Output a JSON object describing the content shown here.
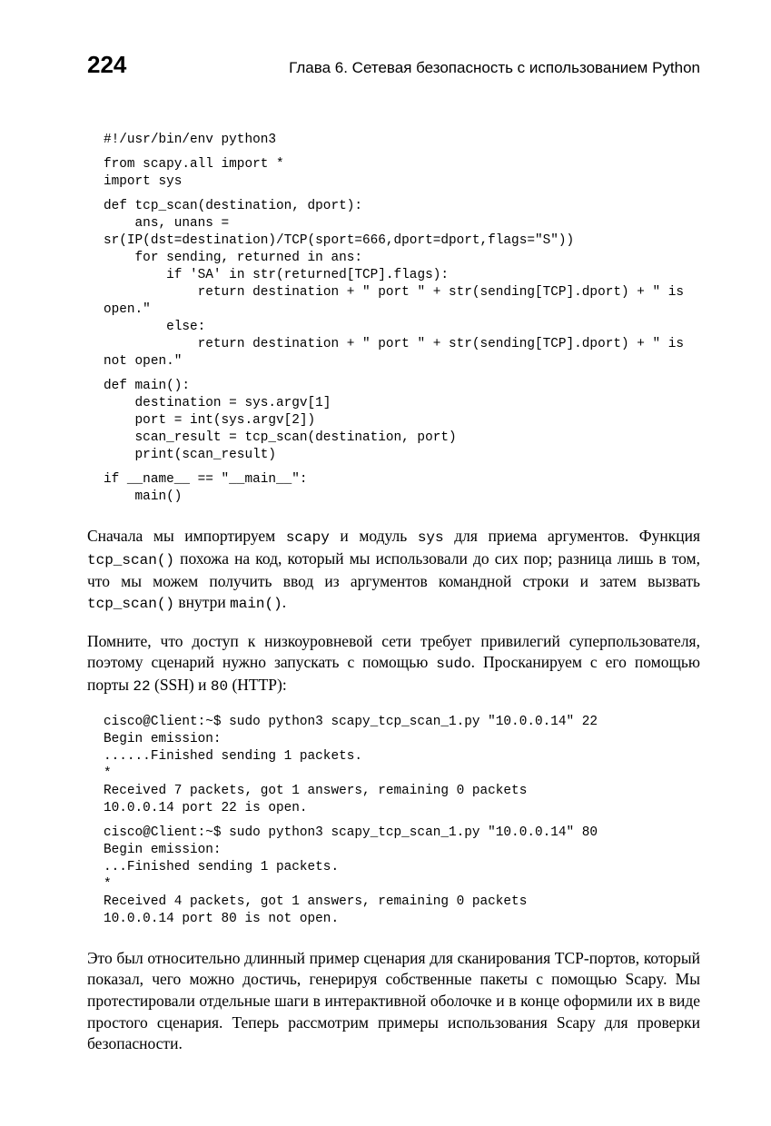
{
  "header": {
    "page_number": "224",
    "chapter_title": "Глава 6. Сетевая безопасность с использованием Python"
  },
  "code1": {
    "l1": "#!/usr/bin/env python3",
    "l2": "from scapy.all import *",
    "l3": "import sys",
    "l4": "def tcp_scan(destination, dport):",
    "l5": "    ans, unans = sr(IP(dst=destination)/TCP(sport=666,dport=dport,flags=\"S\"))",
    "l6": "    for sending, returned in ans:",
    "l7": "        if 'SA' in str(returned[TCP].flags):",
    "l8": "            return destination + \" port \" + str(sending[TCP].dport) + \" is open.\"",
    "l9": "        else:",
    "l10": "            return destination + \" port \" + str(sending[TCP].dport) + \" is not open.\"",
    "l11": "def main():",
    "l12": "    destination = sys.argv[1]",
    "l13": "    port = int(sys.argv[2])",
    "l14": "    scan_result = tcp_scan(destination, port)",
    "l15": "    print(scan_result)",
    "l16": "if __name__ == \"__main__\":",
    "l17": "    main()"
  },
  "para1": {
    "t1": "Сначала мы импортируем ",
    "m1": "scapy",
    "t2": " и модуль ",
    "m2": "sys",
    "t3": " для приема аргументов. Функция ",
    "m3": "tcp_scan()",
    "t4": " похожа на код, который мы использовали до сих пор; разница лишь в том, что мы можем получить ввод из аргументов командной строки и затем вызвать ",
    "m4": "tcp_scan()",
    "t5": " внутри ",
    "m5": "main()",
    "t6": "."
  },
  "para2": {
    "t1": "Помните, что доступ к низкоуровневой сети требует привилегий суперпользователя, поэтому сценарий нужно запускать с помощью ",
    "m1": "sudo",
    "t2": ". Просканируем с его помощью порты ",
    "m2": "22",
    "t3": " (SSH) и ",
    "m3": "80",
    "t4": " (HTTP):"
  },
  "code2": {
    "l1": "cisco@Client:~$ sudo python3 scapy_tcp_scan_1.py \"10.0.0.14\" 22",
    "l2": "Begin emission:",
    "l3": "......Finished sending 1 packets.",
    "l4": "*",
    "l5": "Received 7 packets, got 1 answers, remaining 0 packets",
    "l6": "10.0.0.14 port 22 is open.",
    "l7": "cisco@Client:~$ sudo python3 scapy_tcp_scan_1.py \"10.0.0.14\" 80",
    "l8": "Begin emission:",
    "l9": "...Finished sending 1 packets.",
    "l10": "*",
    "l11": "Received 4 packets, got 1 answers, remaining 0 packets",
    "l12": "10.0.0.14 port 80 is not open."
  },
  "para3": {
    "t1": "Это был относительно длинный пример сценария для сканирования TCP-портов, который показал, чего можно достичь, генерируя собственные пакеты с помощью Scapy. Мы протестировали отдельные шаги в интерактивной оболочке и в конце оформили их в виде простого сценария. Теперь рассмотрим примеры использования Scapy для проверки безопасности."
  }
}
